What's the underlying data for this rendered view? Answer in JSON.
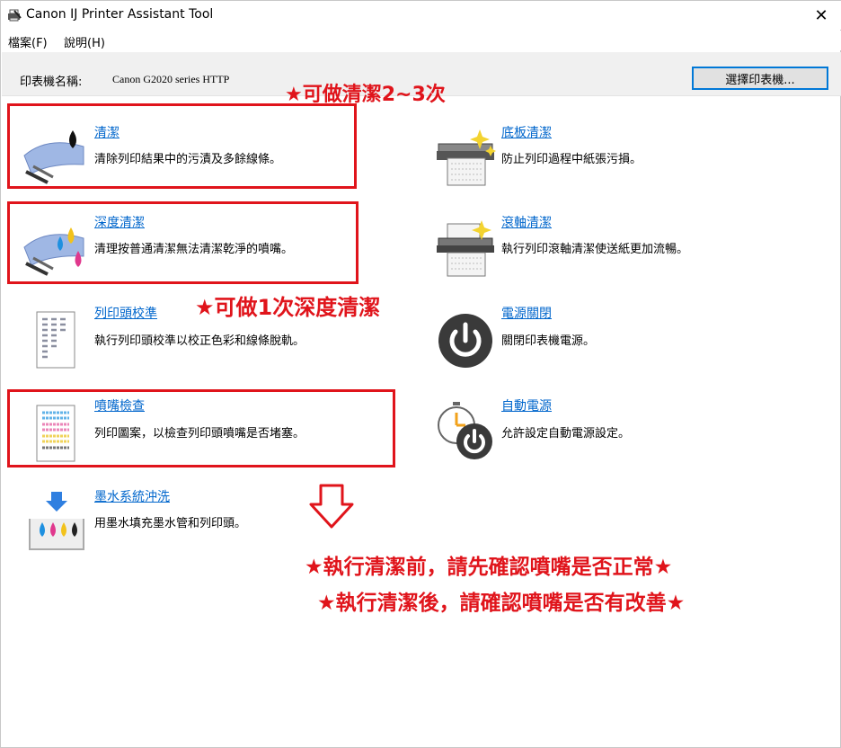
{
  "window": {
    "title": "Canon IJ Printer Assistant Tool",
    "close_glyph": "✕"
  },
  "menu": {
    "file": "檔案(F)",
    "help": "說明(H)"
  },
  "printer": {
    "label": "印表機名稱:",
    "name": "Canon G2020 series HTTP",
    "select_label": "選擇印表機..."
  },
  "items": [
    {
      "title": "清潔",
      "desc": "清除列印結果中的污漬及多餘線條。"
    },
    {
      "title": "底板清潔",
      "desc": "防止列印過程中紙張污損。"
    },
    {
      "title": "深度清潔",
      "desc": "清理按普通清潔無法清潔乾淨的噴嘴。"
    },
    {
      "title": "滾軸清潔",
      "desc": "執行列印滾軸清潔使送紙更加流暢。"
    },
    {
      "title": "列印頭校準",
      "desc": "執行列印頭校準以校正色彩和線條脫軌。"
    },
    {
      "title": "電源關閉",
      "desc": "關閉印表機電源。"
    },
    {
      "title": "噴嘴檢查",
      "desc": "列印圖案，以檢查列印頭噴嘴是否堵塞。"
    },
    {
      "title": "自動電源",
      "desc": "允許設定自動電源設定。"
    },
    {
      "title": "墨水系統沖洗",
      "desc": "用墨水填充墨水管和列印頭。"
    }
  ],
  "annotations": {
    "clean_times": "★可做清潔2~3次",
    "deep_clean_times": "★可做1次深度清潔",
    "before_clean": "★執行清潔前，請先確認噴嘴是否正常★",
    "after_clean": "★執行清潔後，請確認噴嘴是否有改善★"
  },
  "colors": {
    "link": "#0066cc",
    "annotation": "#e0141b",
    "button_border": "#0078d7"
  }
}
